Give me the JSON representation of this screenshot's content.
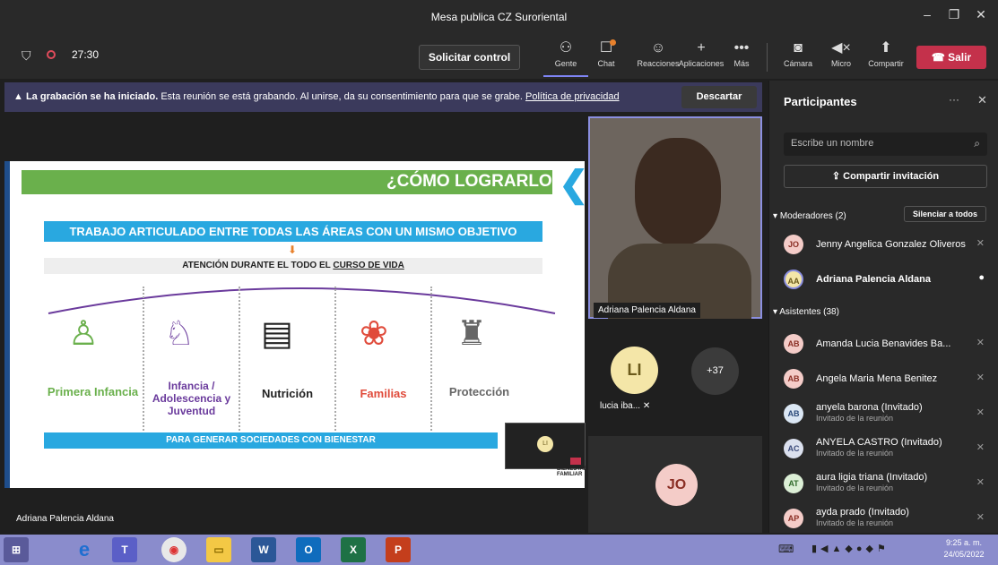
{
  "window": {
    "title": "Mesa publica CZ Suroriental"
  },
  "toolbar": {
    "timer": "27:30",
    "request_control": "Solicitar control",
    "buttons": [
      "Gente",
      "Chat",
      "Reacciones",
      "Aplicaciones",
      "Más",
      "Cámara",
      "Micro",
      "Compartir"
    ],
    "leave": "Salir"
  },
  "banner": {
    "bold": "La grabación se ha iniciado.",
    "text": "Esta reunión se está grabando. Al unirse, da su consentimiento para que se grabe.",
    "link": "Política de privacidad",
    "dismiss": "Descartar"
  },
  "slide": {
    "title": "¿CÓMO LOGRARLO?",
    "banner1": "TRABAJO ARTICULADO ENTRE TODAS LAS ÁREAS CON UN MISMO OBJETIVO",
    "banner2_prefix": "ATENCIÓN DURANTE EL TODO EL ",
    "banner2_link": "CURSO DE VIDA",
    "items": [
      "Primera Infancia",
      "Infancia / Adolescencia y Juventud",
      "Nutrición",
      "Familias",
      "Protección"
    ],
    "footer": "PARA GENERAR SOCIEDADES CON BIENESTAR",
    "logo_text": "BIENESTAR FAMILIAR"
  },
  "video": {
    "main_name": "Adriana Palencia Aldana",
    "speaker_label": "Adriana Palencia Aldana",
    "tile1_initials": "LI",
    "tile1_name": "lucia iba...",
    "overflow": "+37",
    "tile2_initials": "JO"
  },
  "participants": {
    "title": "Participantes",
    "search_placeholder": "Escribe un nombre",
    "share": "Compartir invitación",
    "moderators_label": "Moderadores (2)",
    "mute_all": "Silenciar a todos",
    "attendees_label": "Asistentes (38)",
    "moderators": [
      {
        "initials": "JO",
        "name": "Jenny Angelica Gonzalez Oliveros",
        "sub": ""
      },
      {
        "initials": "AA",
        "name": "Adriana Palencia Aldana",
        "sub": ""
      }
    ],
    "attendees": [
      {
        "initials": "AB",
        "name": "Amanda Lucia Benavides Ba...",
        "sub": ""
      },
      {
        "initials": "AB",
        "name": "Angela Maria Mena Benitez",
        "sub": ""
      },
      {
        "initials": "AB",
        "name": "anyela barona (Invitado)",
        "sub": "Invitado de la reunión"
      },
      {
        "initials": "AC",
        "name": "ANYELA CASTRO (Invitado)",
        "sub": "Invitado de la reunión"
      },
      {
        "initials": "AT",
        "name": "aura ligia triana (Invitado)",
        "sub": "Invitado de la reunión"
      },
      {
        "initials": "AP",
        "name": "ayda prado (Invitado)",
        "sub": "Invitado de la reunión"
      }
    ]
  },
  "taskbar": {
    "time": "9:25 a. m.",
    "date": "24/05/2022"
  },
  "colors": {
    "accent": "#6264a7",
    "leave": "#c4314b",
    "slide_green": "#6ab04c",
    "slide_blue": "#29a8e0"
  }
}
